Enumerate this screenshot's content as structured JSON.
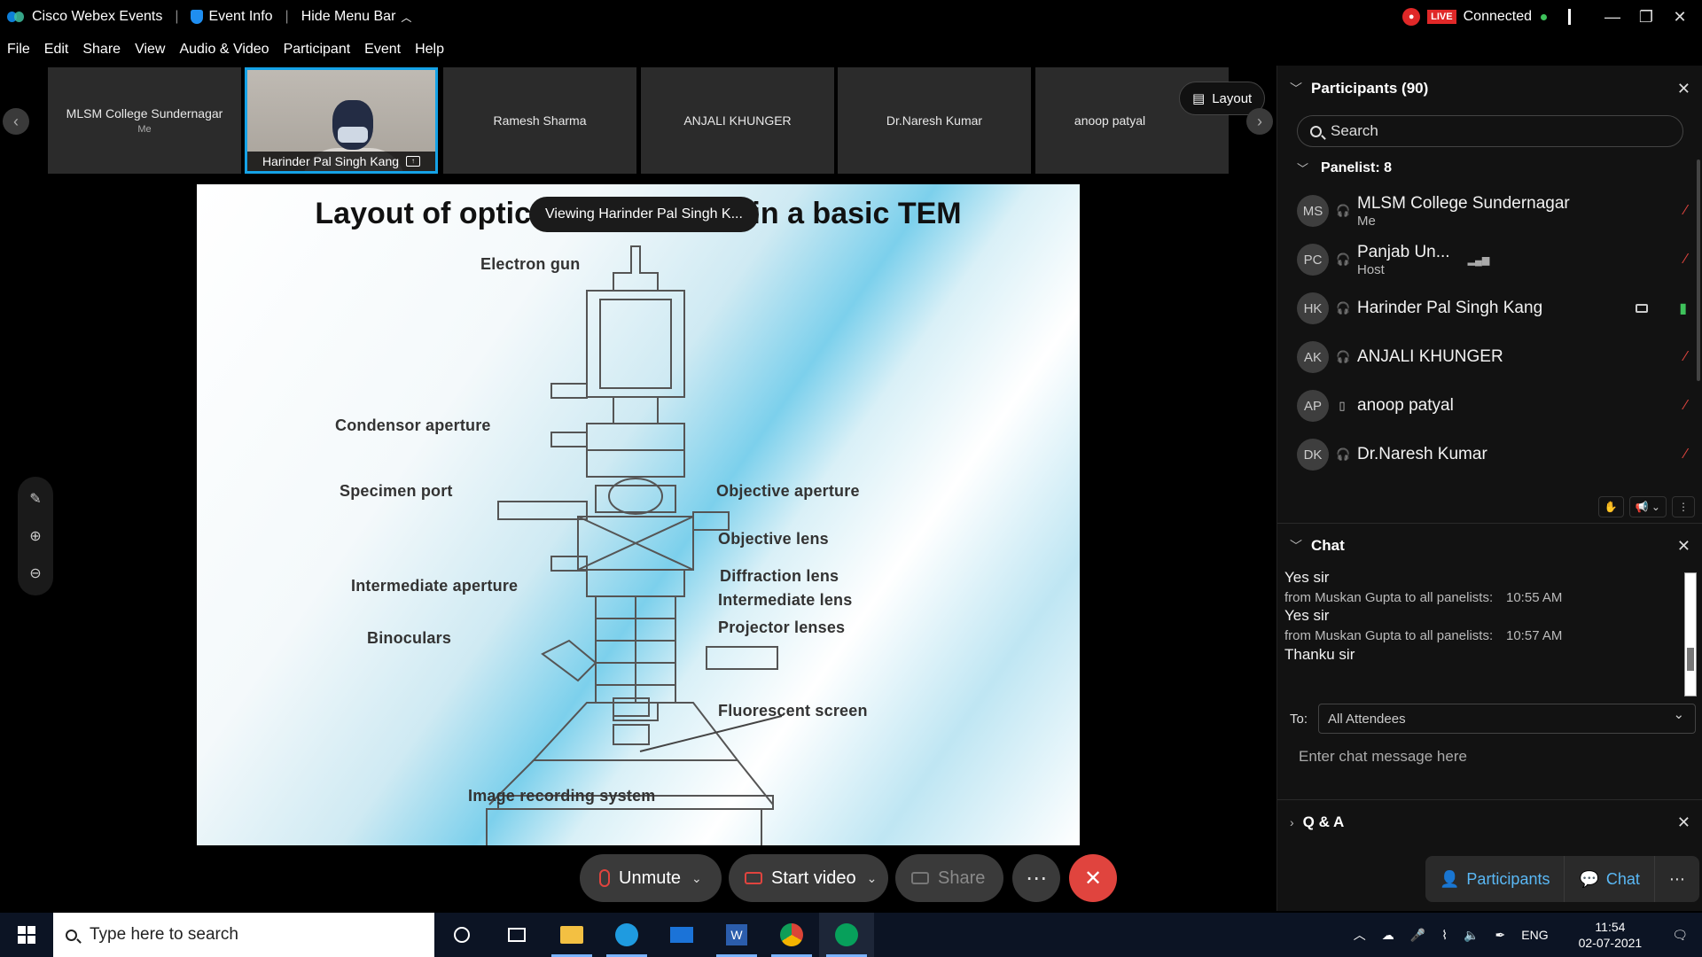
{
  "titlebar": {
    "app_name": "Cisco Webex Events",
    "event_info": "Event Info",
    "hide_menu": "Hide Menu Bar",
    "live_badge": "LIVE",
    "status": "Connected"
  },
  "menu": [
    "File",
    "Edit",
    "Share",
    "View",
    "Audio & Video",
    "Participant",
    "Event",
    "Help"
  ],
  "strip": {
    "tiles": [
      {
        "name": "MLSM College Sundernagar",
        "sub": "Me"
      },
      {
        "name": "Harinder Pal Singh Kang",
        "sub": ""
      },
      {
        "name": "Ramesh Sharma",
        "sub": ""
      },
      {
        "name": "ANJALI KHUNGER",
        "sub": ""
      },
      {
        "name": "Dr.Naresh Kumar",
        "sub": ""
      },
      {
        "name": "anoop patyal",
        "sub": ""
      }
    ],
    "layout_label": "Layout"
  },
  "slide": {
    "title": "Layout of optical components in a basic TEM",
    "viewing": "Viewing Harinder Pal Singh K...",
    "labels": {
      "electron_gun": "Electron gun",
      "condensor_aperture": "Condensor aperture",
      "specimen_port": "Specimen port",
      "objective_aperture": "Objective aperture",
      "objective_lens": "Objective lens",
      "diffraction_lens": "Diffraction lens",
      "intermediate_lens": "Intermediate lens",
      "intermediate_aperture": "Intermediate aperture",
      "projector_lenses": "Projector lenses",
      "binoculars": "Binoculars",
      "fluorescent_screen": "Fluorescent screen",
      "image_recording": "Image recording system"
    }
  },
  "participants": {
    "header": "Participants (90)",
    "search_placeholder": "Search",
    "panelist_header": "Panelist: 8",
    "rows": [
      {
        "initials": "MS",
        "name": "MLSM College Sundernagar",
        "role": "Me"
      },
      {
        "initials": "PC",
        "name": "Panjab Un...",
        "role": "Host"
      },
      {
        "initials": "HK",
        "name": "Harinder Pal Singh Kang",
        "role": ""
      },
      {
        "initials": "AK",
        "name": "ANJALI KHUNGER",
        "role": ""
      },
      {
        "initials": "AP",
        "name": "anoop patyal",
        "role": ""
      },
      {
        "initials": "DK",
        "name": "Dr.Naresh Kumar",
        "role": ""
      }
    ]
  },
  "chat": {
    "header": "Chat",
    "messages": [
      {
        "text": "Yes sir",
        "from": "from Muskan Gupta to all panelists:",
        "time": "10:55 AM"
      },
      {
        "text": "Yes sir",
        "from": "from Muskan Gupta to all panelists:",
        "time": "10:57 AM"
      },
      {
        "text": "Thanku sir",
        "from": "",
        "time": ""
      }
    ],
    "to_label": "To:",
    "to_value": "All Attendees",
    "input_placeholder": "Enter chat message here"
  },
  "qa": {
    "header": "Q & A"
  },
  "controls": {
    "unmute": "Unmute",
    "start_video": "Start video",
    "share": "Share",
    "participants": "Participants",
    "chat": "Chat"
  },
  "taskbar": {
    "search_placeholder": "Type here to search",
    "lang": "ENG",
    "time": "11:54",
    "date": "02-07-2021"
  }
}
